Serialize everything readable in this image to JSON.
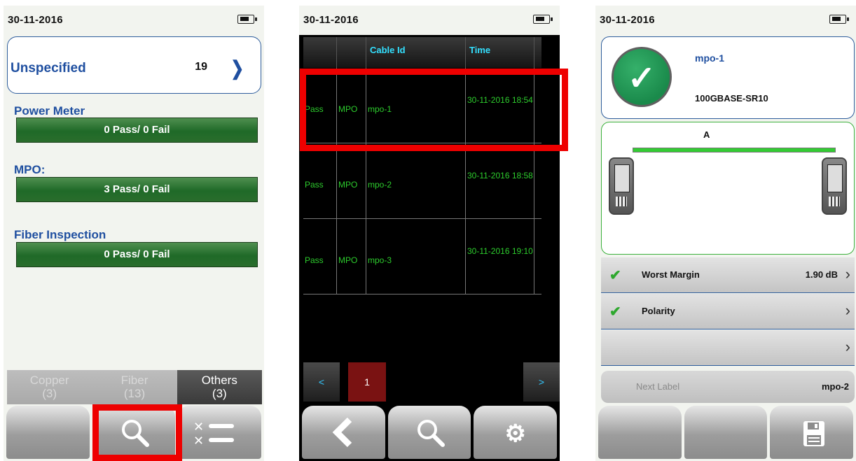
{
  "screen1": {
    "date": "30-11-2016",
    "project": {
      "name": "Unspecified",
      "count": "19"
    },
    "sections": [
      {
        "label": "Power Meter",
        "summary": "0 Pass/ 0 Fail"
      },
      {
        "label": "MPO:",
        "summary": "3 Pass/ 0 Fail"
      },
      {
        "label": "Fiber Inspection",
        "summary": "0 Pass/ 0 Fail"
      }
    ],
    "tabs": [
      {
        "label": "Copper",
        "count": "(3)"
      },
      {
        "label": "Fiber",
        "count": "(13)"
      },
      {
        "label": "Others",
        "count": "(3)"
      }
    ],
    "buttons": [
      "blank",
      "search-icon",
      "delete-list-icon"
    ]
  },
  "screen2": {
    "date": "30-11-2016",
    "columns": [
      "",
      "",
      "Cable Id",
      "Time"
    ],
    "rows": [
      {
        "status": "Pass",
        "type": "MPO",
        "cable_id": "mpo-1",
        "time": "30-11-2016 18:54"
      },
      {
        "status": "Pass",
        "type": "MPO",
        "cable_id": "mpo-2",
        "time": "30-11-2016 18:58"
      },
      {
        "status": "Pass",
        "type": "MPO",
        "cable_id": "mpo-3",
        "time": "30-11-2016 19:10"
      }
    ],
    "pager": {
      "prev": "<",
      "page": "1",
      "next": ">"
    },
    "buttons": [
      "back-icon",
      "search-icon",
      "gear-icon"
    ]
  },
  "screen3": {
    "date": "30-11-2016",
    "result": {
      "name": "mpo-1",
      "standard": "100GBASE-SR10"
    },
    "diagram_label": "A",
    "items": [
      {
        "label": "Worst Margin",
        "value": "1.90 dB",
        "checked": true
      },
      {
        "label": "Polarity",
        "value": "",
        "checked": true
      },
      {
        "label": "",
        "value": "",
        "checked": false
      }
    ],
    "next_label": {
      "label": "Next Label",
      "value": "mpo-2"
    },
    "buttons": [
      "blank",
      "blank",
      "save-icon"
    ]
  },
  "colors": {
    "accent_blue": "#1f4fa0",
    "pass_green": "#2dcc2d",
    "highlight_red": "#ee0000",
    "header_cyan": "#33e0ff"
  }
}
